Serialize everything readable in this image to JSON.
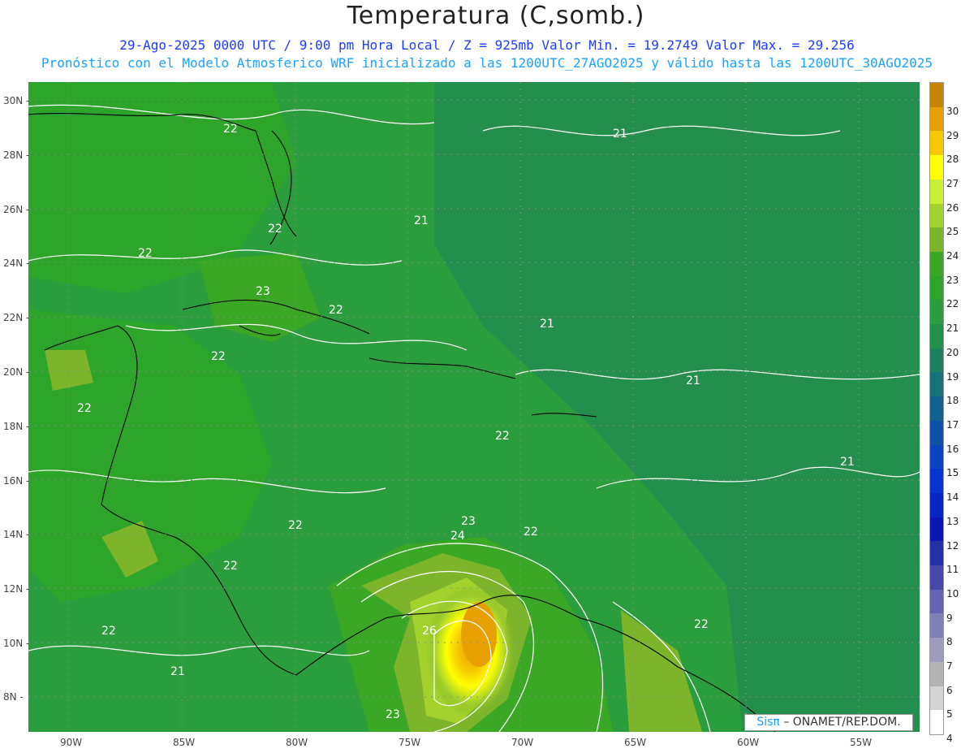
{
  "header": {
    "title": "Temperatura (C,somb.)",
    "line1": "29-Ago-2025  0000 UTC / 9:00 pm Hora Local / Z = 925mb    Valor Min. = 19.2749  Valor Max. = 29.256",
    "line2": "Pronóstico con el Modelo Atmosferico WRF inicializado a las 1200UTC_27AGO2025 y válido hasta las  1200UTC_30AGO2025"
  },
  "credit": {
    "sis": "Sisπ",
    "org": "– ONAMET/REP.DOM."
  },
  "axes": {
    "lat": [
      "30N",
      "28N",
      "26N",
      "24N",
      "22N",
      "20N",
      "18N",
      "16N",
      "14N",
      "12N",
      "10N",
      "8N"
    ],
    "lon": [
      "90W",
      "85W",
      "80W",
      "75W",
      "70W",
      "65W",
      "60W",
      "55W"
    ]
  },
  "colorbar": {
    "levels": [
      "30",
      "29",
      "28",
      "27",
      "26",
      "25",
      "24",
      "23",
      "22",
      "21",
      "20",
      "19",
      "18",
      "17",
      "16",
      "15",
      "14",
      "13",
      "12",
      "11",
      "10",
      "9",
      "8",
      "7",
      "6",
      "5",
      "4"
    ],
    "colors": [
      "#c68400",
      "#e8a000",
      "#f5c800",
      "#ffff00",
      "#cbef36",
      "#a3d12d",
      "#7db52a",
      "#3aa824",
      "#2da52b",
      "#2a9d3c",
      "#248f4d",
      "#1d8060",
      "#167277",
      "#12628f",
      "#0e52a8",
      "#0a44c2",
      "#0733cf",
      "#0526c2",
      "#0a18b3",
      "#2530a8",
      "#4848a8",
      "#6464b3",
      "#8080b8",
      "#9d9dbb",
      "#b3b3b3",
      "#d4d4d4",
      "#ffffff"
    ]
  },
  "contour_labels": [
    "22",
    "22",
    "21",
    "21",
    "22",
    "22",
    "23",
    "22",
    "21",
    "22",
    "21",
    "22",
    "22",
    "21",
    "23",
    "24",
    "22",
    "22",
    "22",
    "26",
    "22",
    "21",
    "23"
  ]
}
